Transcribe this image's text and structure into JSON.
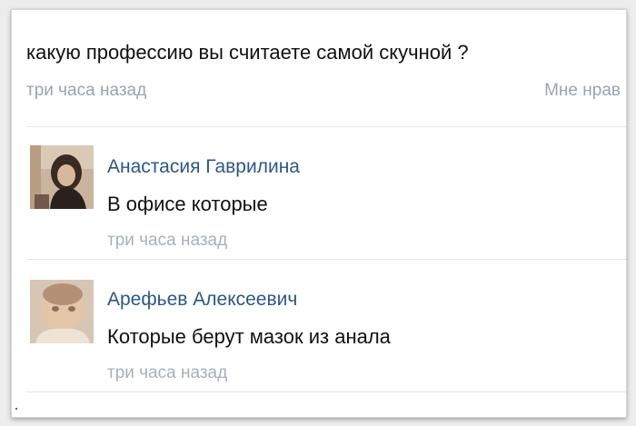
{
  "post": {
    "text": "какую профессию вы считаете самой скучной ?",
    "timestamp": "три часа назад",
    "like_label": "Мне нрав"
  },
  "comments": [
    {
      "author": "Анастасия Гаврилина",
      "text": "В офисе которые",
      "timestamp": "три часа назад"
    },
    {
      "author": "Арефьев Алексеевич",
      "text": "Которые берут мазок из анала",
      "timestamp": "три часа назад"
    }
  ],
  "colors": {
    "author_link": "#2b5887",
    "meta_text": "#9aa4ae",
    "body_text": "#111111",
    "divider": "#e3e6ea"
  }
}
